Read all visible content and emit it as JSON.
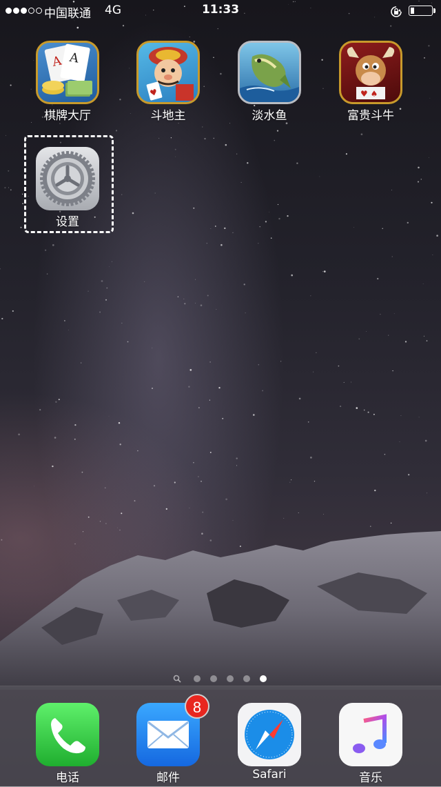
{
  "status_bar": {
    "signal_bars": "●●●○○",
    "carrier": "中国联通",
    "network": "4G",
    "time": "11:33",
    "battery_level_percent": 15
  },
  "home": {
    "apps": [
      {
        "label": "棋牌大厅",
        "icon": "poker-cards-icon"
      },
      {
        "label": "斗地主",
        "icon": "landlord-game-icon"
      },
      {
        "label": "淡水鱼",
        "icon": "freshwater-fish-icon"
      },
      {
        "label": "富贵斗牛",
        "icon": "bull-fight-game-icon"
      },
      {
        "label": "设置",
        "icon": "settings-gear-icon",
        "highlighted": true
      }
    ],
    "pages": 5,
    "current_page": 5
  },
  "dock": {
    "apps": [
      {
        "label": "电话",
        "icon": "phone-icon"
      },
      {
        "label": "邮件",
        "icon": "mail-icon",
        "badge": "8"
      },
      {
        "label": "Safari",
        "icon": "safari-compass-icon"
      },
      {
        "label": "音乐",
        "icon": "music-note-icon"
      }
    ]
  },
  "colors": {
    "highlight_border": "#ffffff",
    "badge": "#e8261f",
    "phone_green": "#2fc94a",
    "mail_blue": "#1e8ff2"
  }
}
